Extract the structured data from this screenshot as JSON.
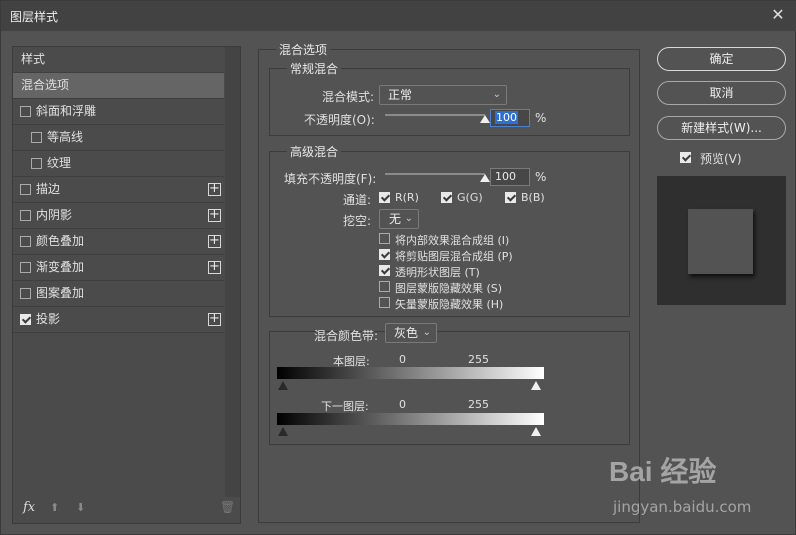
{
  "window": {
    "title": "图层样式",
    "close_icon": "close-icon"
  },
  "left": {
    "items": [
      {
        "label": "样式",
        "checkbox": false,
        "plus": false
      },
      {
        "label": "混合选项",
        "checkbox": false,
        "plus": false,
        "selected": true
      },
      {
        "label": "斜面和浮雕",
        "checkbox": true,
        "checked": false,
        "plus": false
      },
      {
        "label": "等高线",
        "checkbox": true,
        "checked": false,
        "plus": false,
        "indent": true
      },
      {
        "label": "纹理",
        "checkbox": true,
        "checked": false,
        "plus": false,
        "indent": true
      },
      {
        "label": "描边",
        "checkbox": true,
        "checked": false,
        "plus": true
      },
      {
        "label": "内阴影",
        "checkbox": true,
        "checked": false,
        "plus": true
      },
      {
        "label": "颜色叠加",
        "checkbox": true,
        "checked": false,
        "plus": true
      },
      {
        "label": "渐变叠加",
        "checkbox": true,
        "checked": false,
        "plus": true
      },
      {
        "label": "图案叠加",
        "checkbox": true,
        "checked": false,
        "plus": false
      },
      {
        "label": "投影",
        "checkbox": true,
        "checked": true,
        "plus": true
      }
    ],
    "footer": {
      "fx": "fx",
      "up_icon": "arrow-up-icon",
      "down_icon": "arrow-down-icon",
      "trash_icon": "trash-icon"
    }
  },
  "blend": {
    "section_title": "混合选项",
    "general": {
      "title": "常规混合",
      "mode_label": "混合模式:",
      "mode_value": "正常",
      "opacity_label": "不透明度(O):",
      "opacity_value": "100",
      "opacity_unit": "%",
      "opacity_level": 1.0
    },
    "advanced": {
      "title": "高级混合",
      "fill_label": "填充不透明度(F):",
      "fill_value": "100",
      "fill_unit": "%",
      "fill_level": 1.0,
      "channels_label": "通道:",
      "channels": [
        {
          "label": "R(R)",
          "checked": true
        },
        {
          "label": "G(G)",
          "checked": true
        },
        {
          "label": "B(B)",
          "checked": true
        }
      ],
      "knockout_label": "挖空:",
      "knockout_value": "无",
      "options": [
        {
          "label": "将内部效果混合成组 (I)",
          "checked": false
        },
        {
          "label": "将剪贴图层混合成组 (P)",
          "checked": true
        },
        {
          "label": "透明形状图层 (T)",
          "checked": true
        },
        {
          "label": "图层蒙版隐藏效果 (S)",
          "checked": false
        },
        {
          "label": "矢量蒙版隐藏效果 (H)",
          "checked": false
        }
      ]
    },
    "blend_if": {
      "label": "混合颜色带:",
      "value": "灰色",
      "this_layer": {
        "label": "本图层:",
        "low": "0",
        "high": "255"
      },
      "underlying": {
        "label": "下一图层:",
        "low": "0",
        "high": "255"
      }
    }
  },
  "right": {
    "ok": "确定",
    "cancel": "取消",
    "new_style": "新建样式(W)...",
    "preview_label": "预览(V)",
    "preview_checked": true
  },
  "watermark": {
    "line1": "Bai 经验",
    "line2": "jingyan.baidu.com"
  }
}
